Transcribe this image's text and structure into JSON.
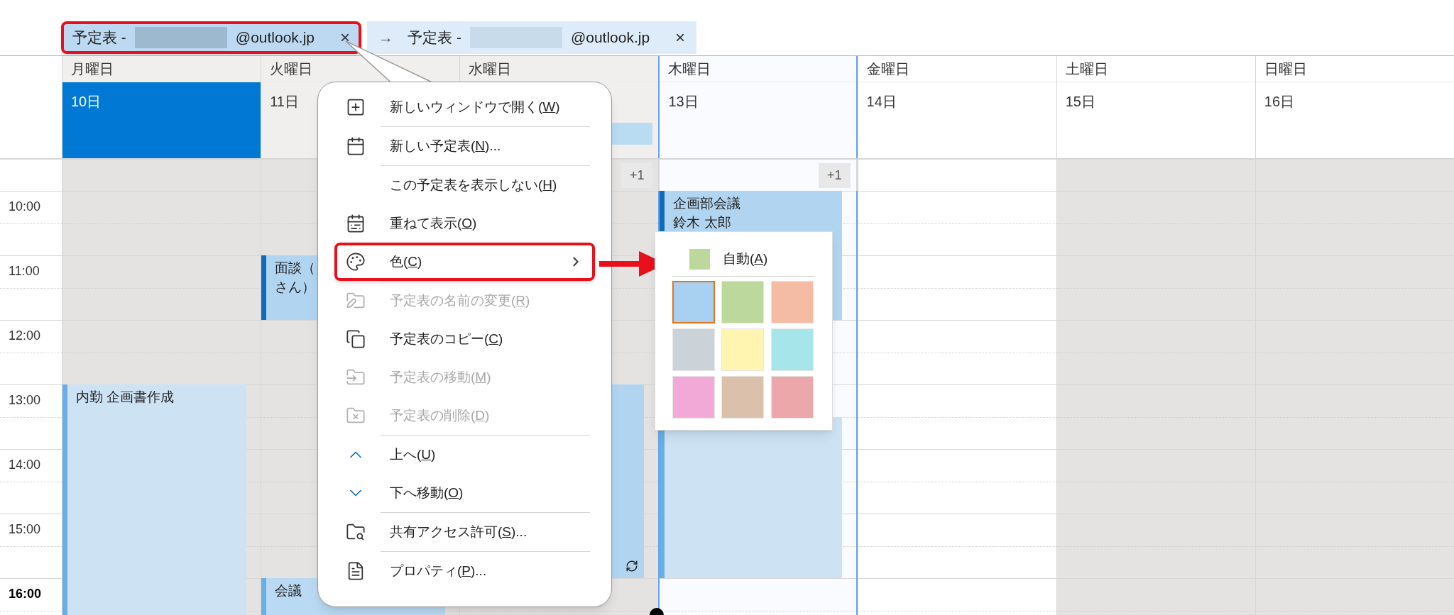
{
  "tabs": [
    {
      "prefix": "予定表 -",
      "suffix": "@outlook.jp",
      "close": "×",
      "selected": true,
      "highlighted": true
    },
    {
      "arrow": "→",
      "prefix": "予定表 -",
      "suffix": "@outlook.jp",
      "close": "×",
      "selected": false,
      "highlighted": false
    }
  ],
  "days": [
    {
      "weekday": "月曜日",
      "date": "10日",
      "selected": true,
      "past": true,
      "shaded": true,
      "focused": false,
      "banner": false,
      "events": [
        {
          "color": "#cde3f4",
          "recurring": false,
          "lines": [
            "内勤 企画書作成"
          ]
        }
      ]
    },
    {
      "weekday": "火曜日",
      "date": "11日",
      "selected": false,
      "past": true,
      "shaded": true,
      "focused": false,
      "banner": false,
      "events": [
        {
          "color": "#b1d5f1",
          "lines": [
            "面談（",
            "さん）"
          ]
        },
        {
          "color": "#b9daf2",
          "lines": [
            "会議"
          ]
        }
      ]
    },
    {
      "weekday": "水曜日",
      "selected": false,
      "past": true,
      "shaded": true,
      "focused": false,
      "banner": true,
      "more": "+1",
      "events": [
        {
          "color": "#b1d5f1",
          "recurring": true
        }
      ]
    },
    {
      "weekday": "木曜日",
      "date": "13日",
      "selected": false,
      "past": false,
      "shaded": false,
      "focused": true,
      "banner": false,
      "more": "+1",
      "events": [
        {
          "color": "#b1d5f1",
          "recurring": false,
          "lines": [
            "企画部会議",
            "鈴木 太郎"
          ]
        },
        {
          "color": "#cde3f4",
          "recurring": false
        }
      ]
    },
    {
      "weekday": "金曜日",
      "date": "14日",
      "selected": false,
      "past": false,
      "shaded": false,
      "focused": false,
      "banner": false
    },
    {
      "weekday": "土曜日",
      "date": "15日",
      "selected": false,
      "past": false,
      "shaded": true,
      "focused": false,
      "banner": false
    },
    {
      "weekday": "日曜日",
      "date": "16日",
      "selected": false,
      "past": false,
      "shaded": true,
      "focused": false,
      "banner": false
    }
  ],
  "times": [
    {
      "label": "10:00",
      "current": false
    },
    {
      "label": "11:00",
      "current": false
    },
    {
      "label": "12:00",
      "current": false
    },
    {
      "label": "13:00",
      "current": false
    },
    {
      "label": "14:00",
      "current": false
    },
    {
      "label": "15:00",
      "current": false
    },
    {
      "label": "16:00",
      "current": true
    }
  ],
  "menu": {
    "groups": [
      [
        {
          "kind": "new-window",
          "label": "新しいウィンドウで開く(",
          "key": "W",
          "tail": ")",
          "disabled": false,
          "highlighted": false
        }
      ],
      [
        {
          "kind": "new-calendar",
          "label": "新しい予定表(",
          "key": "N",
          "tail": ")...",
          "disabled": false,
          "highlighted": false
        }
      ],
      [
        {
          "kind": "hide",
          "label": "この予定表を表示しない(",
          "key": "H",
          "tail": ")",
          "disabled": false,
          "highlighted": false
        },
        {
          "kind": "overlay",
          "label": "重ねて表示(",
          "key": "O",
          "tail": ")",
          "disabled": false,
          "highlighted": false
        },
        {
          "kind": "color",
          "label": "色(",
          "key": "C",
          "tail": ")",
          "disabled": false,
          "highlighted": true
        }
      ],
      [
        {
          "kind": "rename",
          "label": "予定表の名前の変更(",
          "key": "R",
          "tail": ")",
          "disabled": true,
          "highlighted": false
        },
        {
          "kind": "copy",
          "label": "予定表のコピー(",
          "key": "C",
          "tail": ")",
          "disabled": false,
          "highlighted": false
        },
        {
          "kind": "move",
          "label": "予定表の移動(",
          "key": "M",
          "tail": ")",
          "disabled": true,
          "highlighted": false
        },
        {
          "kind": "delete",
          "label": "予定表の削除(",
          "key": "D",
          "tail": ")",
          "disabled": true,
          "highlighted": false
        }
      ],
      [
        {
          "kind": "up",
          "label": "上へ(",
          "key": "U",
          "tail": ")",
          "disabled": false,
          "highlighted": false
        },
        {
          "kind": "down",
          "label": "下へ移動(",
          "key": "O",
          "tail": ")",
          "disabled": false,
          "highlighted": false
        }
      ],
      [
        {
          "kind": "share",
          "label": "共有アクセス許可(",
          "key": "S",
          "tail": ")...",
          "disabled": false,
          "highlighted": false
        }
      ],
      [
        {
          "kind": "properties",
          "label": "プロパティ(",
          "key": "P",
          "tail": ")...",
          "disabled": false,
          "highlighted": false
        }
      ]
    ]
  },
  "color_menu": {
    "auto": {
      "label": "自動(",
      "key": "A",
      "tail": ")",
      "color": "#bdd89c"
    },
    "swatches": [
      {
        "color": "#a8d0f0",
        "selected": true
      },
      {
        "color": "#bdd89c",
        "selected": false
      },
      {
        "color": "#f4bba5",
        "selected": false
      },
      {
        "color": "#ccd3d8",
        "selected": false
      },
      {
        "color": "#fff5b0",
        "selected": false
      },
      {
        "color": "#a6e6ea",
        "selected": false
      },
      {
        "color": "#f3a9d8",
        "selected": false
      },
      {
        "color": "#dbc0ab",
        "selected": false
      },
      {
        "color": "#eba7aa",
        "selected": false
      }
    ]
  }
}
